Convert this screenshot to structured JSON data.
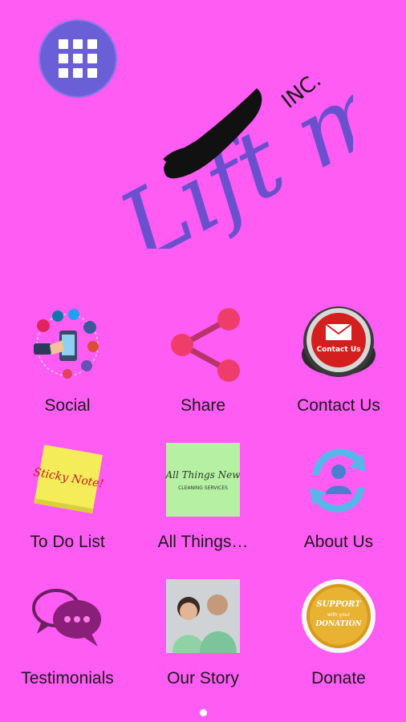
{
  "logo": {
    "line1": "Lift me Up",
    "line2": "INC."
  },
  "tiles": [
    {
      "label": "Social",
      "icon": "social-media-icon"
    },
    {
      "label": "Share",
      "icon": "share-icon"
    },
    {
      "label": "Contact Us",
      "icon": "contact-us-icon",
      "icon_text": "Contact Us"
    },
    {
      "label": "To Do List",
      "icon": "sticky-note-icon",
      "icon_text": "Sticky Note!"
    },
    {
      "label": "All Things…",
      "icon": "all-things-new-logo-icon",
      "icon_text": "All Things New",
      "icon_subtext": "CLEANING SERVICES"
    },
    {
      "label": "About Us",
      "icon": "about-us-icon"
    },
    {
      "label": "Testimonials",
      "icon": "testimonials-chat-icon"
    },
    {
      "label": "Our Story",
      "icon": "our-story-photo-icon"
    },
    {
      "label": "Donate",
      "icon": "donate-badge-icon",
      "icon_text": "SUPPORT",
      "icon_subtext": "with your",
      "icon_text2": "DONATION"
    }
  ],
  "colors": {
    "background": "#ff5cf3",
    "menu_button": "#6b5fd8",
    "logo_text": "#5a4fc8"
  },
  "pager": {
    "pages": 1,
    "active": 1
  }
}
